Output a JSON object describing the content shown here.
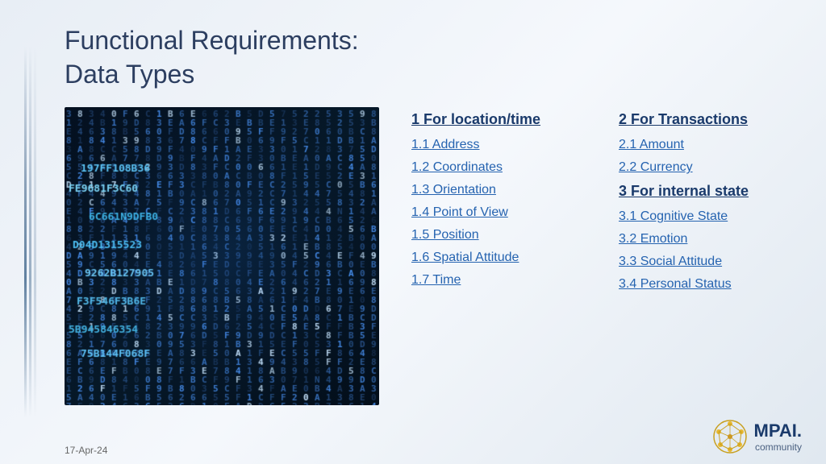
{
  "slide": {
    "title_line1": "Functional Requirements:",
    "title_line2": "Data Types",
    "footer_date": "17-Apr-24"
  },
  "column1": {
    "header": "1 For location/time",
    "items": [
      "1.1  Address",
      "1.2  Coordinates",
      "1.3  Orientation",
      "1.4  Point of View",
      "1.5  Position",
      "1.6  Spatial Attitude",
      "1.7  Time"
    ]
  },
  "column2": {
    "header1": "2 For Transactions",
    "items1": [
      "2.1  Amount",
      "2.2  Currency"
    ],
    "header2": "3 For internal state",
    "items2": [
      "3.1  Cognitive State",
      "3.2  Emotion",
      "3.3  Social Attitude",
      "3.4  Personal Status"
    ]
  },
  "logo": {
    "text": "MPAI.",
    "subtext": "community"
  }
}
